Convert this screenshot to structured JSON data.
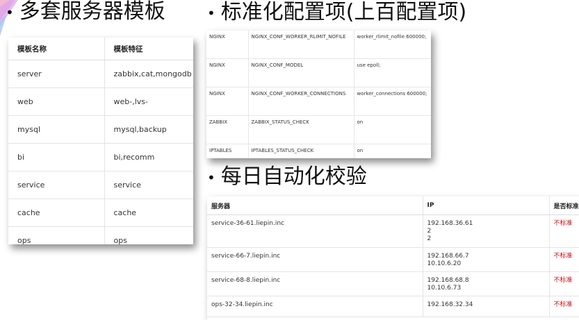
{
  "headings": {
    "templates": "多套服务器模板",
    "config": "标准化配置项(上百配置项)",
    "check": "每日自动化校验"
  },
  "template_table": {
    "headers": [
      "模板名称",
      "模板特征"
    ],
    "rows": [
      [
        "server",
        "zabbix,cat,mongodb"
      ],
      [
        "web",
        "web-,lvs-"
      ],
      [
        "mysql",
        "mysql,backup"
      ],
      [
        "bi",
        "bi,recomm"
      ],
      [
        "service",
        "service"
      ],
      [
        "cache",
        "cache"
      ],
      [
        "ops",
        "ops"
      ]
    ]
  },
  "config_table": {
    "rows": [
      [
        "NGINX",
        "NGINX_CONF_WORKER_RLIMIT_NOFILE",
        "worker_rlimit_nofile 600000;"
      ],
      [
        "NGINX",
        "NGINX_CONF_MODEL",
        "use epoll;"
      ],
      [
        "NGINX",
        "NGINX_CONF_WORKER_CONNECTIONS",
        "worker_connections 600000;"
      ],
      [
        "ZABBIX",
        "ZABBIX_STATUS_CHECK",
        "on"
      ],
      [
        "IPTABLES",
        "IPTABLES_STATUS_CHECK",
        "on"
      ]
    ]
  },
  "check_table": {
    "headers": [
      "服务器",
      "IP",
      "是否标准"
    ],
    "rows": [
      {
        "server": "service-36-61.liepin.inc",
        "ip": [
          "192.168.36.61",
          "2",
          "2"
        ],
        "status": "不标准"
      },
      {
        "server": "service-66-7.liepin.inc",
        "ip": [
          "192.168.66.7",
          "10.10.6.20"
        ],
        "status": "不标准"
      },
      {
        "server": "service-68-8.liepin.inc",
        "ip": [
          "192.168.68.8",
          "10.10.6.73"
        ],
        "status": "不标准"
      },
      {
        "server": "ops-32-34.liepin.inc",
        "ip": [
          "192.168.32.34"
        ],
        "status": "不标准"
      }
    ]
  },
  "colors": {
    "nonstandard": "#cc1111",
    "deco_pink": "#e84b8a",
    "deco_purple": "#b23bd1",
    "deco_blue": "#3a6fd8"
  }
}
